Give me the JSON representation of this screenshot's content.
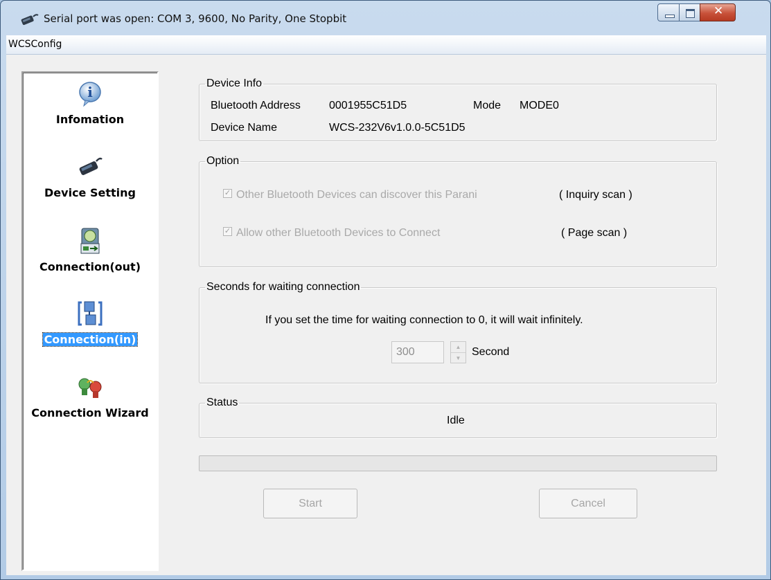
{
  "window": {
    "title": "Serial port was open: COM 3, 9600, No Parity, One Stopbit"
  },
  "menu": {
    "items": [
      "WCSConfig"
    ]
  },
  "sidebar": {
    "items": [
      {
        "label": "Infomation",
        "icon": "info-icon",
        "selected": false
      },
      {
        "label": "Device Setting",
        "icon": "device-icon",
        "selected": false
      },
      {
        "label": "Connection(out)",
        "icon": "connection-out-icon",
        "selected": false
      },
      {
        "label": "Connection(in)",
        "icon": "connection-in-icon",
        "selected": true
      },
      {
        "label": "Connection Wizard",
        "icon": "wizard-icon",
        "selected": false
      }
    ]
  },
  "device_info": {
    "legend": "Device Info",
    "bt_address_label": "Bluetooth Address",
    "bt_address_value": "0001955C51D5",
    "mode_label": "Mode",
    "mode_value": "MODE0",
    "device_name_label": "Device Name",
    "device_name_value": "WCS-232V6v1.0.0-5C51D5"
  },
  "option": {
    "legend": "Option",
    "inquiry_label": "Other Bluetooth Devices can discover this Parani",
    "inquiry_note": "( Inquiry scan )",
    "inquiry_checked": true,
    "page_label": "Allow other Bluetooth Devices to Connect",
    "page_note": "( Page scan )",
    "page_checked": true
  },
  "waiting": {
    "legend": "Seconds for waiting connection",
    "description": "If you set the time for waiting connection to 0, it will wait infinitely.",
    "value": "300",
    "unit": "Second"
  },
  "status": {
    "legend": "Status",
    "value": "Idle"
  },
  "progress": 0,
  "buttons": {
    "start": "Start",
    "cancel": "Cancel"
  }
}
